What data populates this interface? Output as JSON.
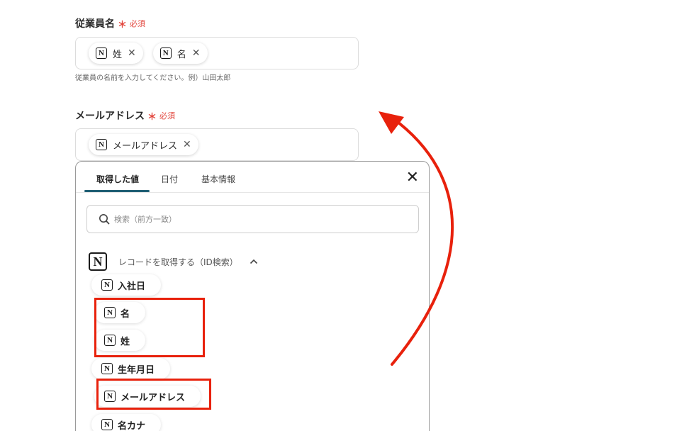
{
  "form": {
    "employee_name": {
      "label": "従業員名",
      "required_mark": "＊",
      "required_text": "必須",
      "chips": [
        {
          "label": "姓",
          "icon": "notion-icon"
        },
        {
          "label": "名",
          "icon": "notion-icon"
        }
      ],
      "helper": "従業員の名前を入力してください。例）山田太郎"
    },
    "email": {
      "label": "メールアドレス",
      "required_mark": "＊",
      "required_text": "必須",
      "chips": [
        {
          "label": "メールアドレス",
          "icon": "notion-icon"
        }
      ]
    }
  },
  "panel": {
    "tabs": [
      {
        "label": "取得した値",
        "active": true
      },
      {
        "label": "日付",
        "active": false
      },
      {
        "label": "基本情報",
        "active": false
      }
    ],
    "close_glyph": "✕",
    "search_placeholder": "検索（前方一致）",
    "section_title": "レコードを取得する（ID検索）",
    "items": [
      "入社日",
      "名",
      "姓",
      "生年月日",
      "メールアドレス",
      "名カナ"
    ]
  },
  "icons": {
    "notion_glyph": "N",
    "chip_close": "✕",
    "search": "search-icon",
    "chevron": "chevron-up-icon"
  },
  "colors": {
    "required": "#e2453c",
    "highlight": "#e8210c",
    "tab_underline": "#1f5f74"
  }
}
